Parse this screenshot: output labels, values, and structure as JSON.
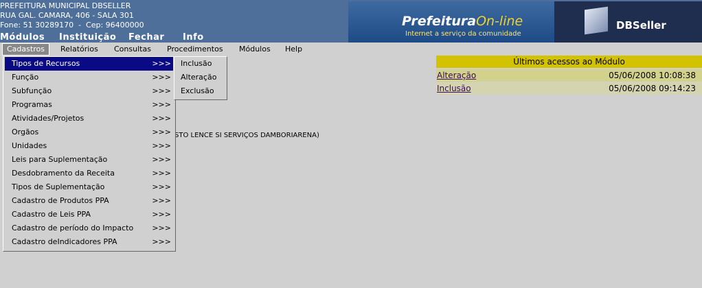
{
  "header": {
    "org_lines": [
      "PREFEITURA MUNICIPAL DBSELLER",
      "RUA GAL. CAMARA, 406 - SALA 301",
      "Fone: 51 30289170  -  Cep: 96400000"
    ],
    "top_menu": [
      "Módulos",
      "Instituição",
      "Fechar",
      "Info"
    ],
    "logo_brand": "Prefeitura",
    "logo_brand_suffix": "On-line",
    "logo_tagline": "Internet a serviço da comunidade",
    "db_logo": "DBSeller"
  },
  "menubar": [
    "Cadastros",
    "Relatórios",
    "Consultas",
    "Procedimentos",
    "Módulos",
    "Help"
  ],
  "dropdown": {
    "arrow": ">>>",
    "items": [
      "Tipos de Recursos",
      "Função",
      "Subfunção",
      "Programas",
      "Atividades/Projetos",
      "Orgãos",
      "Unidades",
      "Leis para Suplementação",
      "Desdobramento da Receita",
      "Tipos de Suplementação",
      "Cadastro de Produtos PPA",
      "Cadastro de Leis PPA",
      "Cadastro de período do Impacto",
      "Cadastro deIndicadores PPA"
    ]
  },
  "submenu": [
    "Inclusão",
    "Alteração",
    "Exclusão"
  ],
  "recent": {
    "title": "Últimos acessos ao Módulo",
    "rows": [
      {
        "label": "Alteração",
        "datetime": "05/06/2008 10:08:38",
        "bg": "#d2d28c"
      },
      {
        "label": "Inclusão",
        "datetime": "05/06/2008 09:14:23",
        "bg": "#d4d4b0"
      }
    ]
  },
  "background_text": "STO LENCE SI SERVIÇOS DAMBORIARENA)"
}
